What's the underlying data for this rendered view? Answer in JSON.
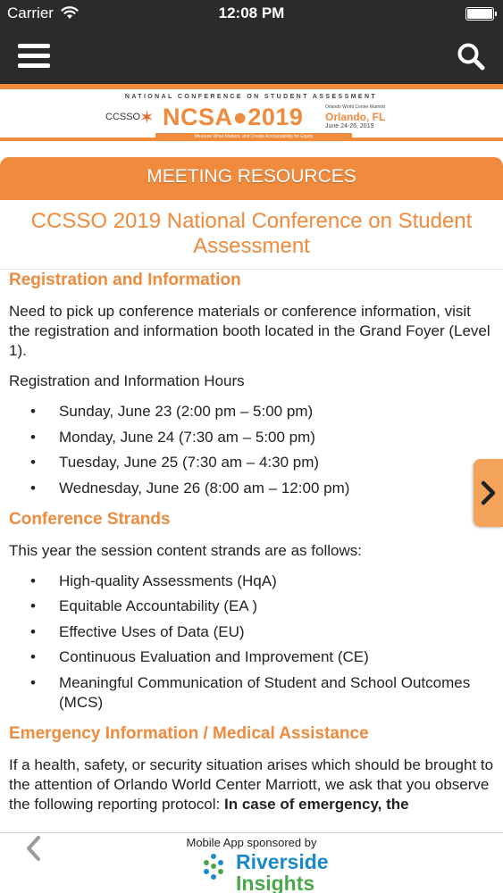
{
  "status_bar": {
    "carrier": "Carrier",
    "time": "12:08 PM"
  },
  "banner": {
    "top_text": "NATIONAL CONFERENCE ON STUDENT ASSESSMENT",
    "org": "CCSSO",
    "title": "NCSA●2019",
    "venue": "Orlando World Center Marriott",
    "city": "Orlando, FL",
    "dates": "June 24-26, 2019",
    "tagline": "Measure What Matters, and Create Accountability for Equity"
  },
  "header": {
    "section_title": "MEETING RESOURCES"
  },
  "page": {
    "title": "CCSSO 2019 National Conference on Student Assessment"
  },
  "registration": {
    "heading": "Registration and Information",
    "intro": "Need to pick up conference materials or conference information, visit the registration and information booth located in the Grand Foyer (Level 1).",
    "hours_label": "Registration and Information Hours",
    "hours": [
      "Sunday, June 23 (2:00 pm – 5:00 pm)",
      "Monday, June 24 (7:30 am – 5:00 pm)",
      "Tuesday, June 25 (7:30 am – 4:30 pm)",
      "Wednesday, June 26 (8:00 am – 12:00 pm)"
    ]
  },
  "strands": {
    "heading": "Conference Strands",
    "intro": "This year the session content strands are as follows:",
    "items": [
      "High-quality Assessments (HqA)",
      "Equitable Accountability (EA )",
      "Effective Uses of Data (EU)",
      "Continuous Evaluation and Improvement (CE)",
      "Meaningful Communication of Student and School Outcomes (MCS)"
    ]
  },
  "emergency": {
    "heading": "Emergency Information / Medical Assistance",
    "text": "If a health, safety, or security situation arises which should be brought to the attention of Orlando World Center Marriott, we ask that you observe the following reporting protocol: ",
    "text_bold": "In case of emergency, the"
  },
  "footer": {
    "sponsor_text": "Mobile App sponsored by",
    "sponsor_name_line1": "Riverside",
    "sponsor_name_line2": "Insights"
  },
  "colors": {
    "accent": "#f08a3c",
    "topbar": "#2b2b2b",
    "sponsor_blue": "#1a8ac9",
    "sponsor_green": "#4aa84a"
  },
  "icons": [
    "menu-icon",
    "search-icon",
    "chevron-right-icon",
    "chevron-left-icon",
    "wifi-icon",
    "battery-icon"
  ]
}
